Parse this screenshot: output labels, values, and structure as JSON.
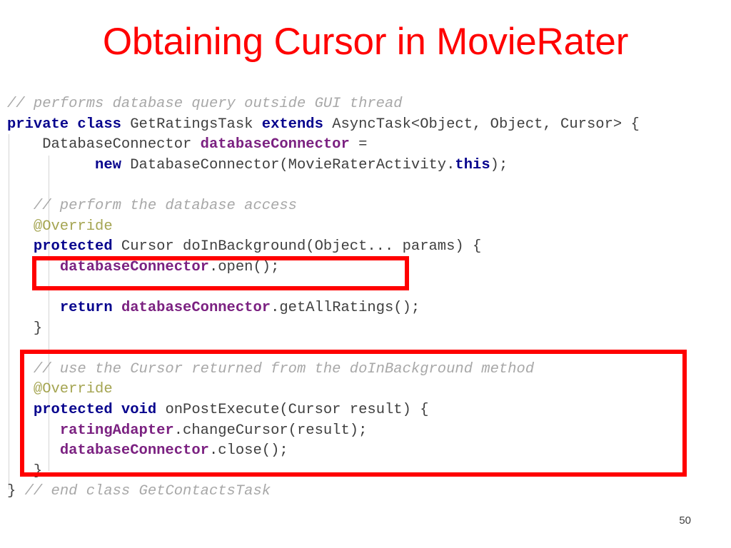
{
  "slide": {
    "title": "Obtaining Cursor in MovieRater",
    "title_color": "#ff0000",
    "page_number": "50",
    "background_color": "#ffffff"
  },
  "syntax_colors": {
    "comment": "#a8a8a8",
    "keyword": "#06038d",
    "variable": "#7b2181",
    "annotation": "#a5a552",
    "plain": "#3f3f3f",
    "highlight_box": "#ff0000"
  },
  "code": {
    "language": "java",
    "lines": [
      {
        "id": "line-1",
        "tokens": [
          {
            "t": "cmt",
            "s": "// performs database query outside GUI thread"
          }
        ]
      },
      {
        "id": "line-2",
        "tokens": [
          {
            "t": "kw",
            "s": "private class"
          },
          {
            "t": "pln",
            "s": " GetRatingsTask "
          },
          {
            "t": "kw",
            "s": "extends"
          },
          {
            "t": "pln",
            "s": " AsyncTask<Object, Object, Cursor> {"
          }
        ]
      },
      {
        "id": "line-3",
        "tokens": [
          {
            "t": "pln",
            "s": "    DatabaseConnector "
          },
          {
            "t": "var",
            "s": "databaseConnector"
          },
          {
            "t": "pln",
            "s": " ="
          }
        ]
      },
      {
        "id": "line-4",
        "tokens": [
          {
            "t": "pln",
            "s": "          "
          },
          {
            "t": "kw",
            "s": "new"
          },
          {
            "t": "pln",
            "s": " DatabaseConnector(MovieRaterActivity."
          },
          {
            "t": "kw",
            "s": "this"
          },
          {
            "t": "pln",
            "s": ");"
          }
        ]
      },
      {
        "id": "line-5",
        "tokens": [
          {
            "t": "pln",
            "s": ""
          }
        ]
      },
      {
        "id": "line-6",
        "tokens": [
          {
            "t": "pln",
            "s": "   "
          },
          {
            "t": "cmt",
            "s": "// perform the database access"
          }
        ]
      },
      {
        "id": "line-7",
        "tokens": [
          {
            "t": "pln",
            "s": "   "
          },
          {
            "t": "ann",
            "s": "@Override"
          }
        ]
      },
      {
        "id": "line-8",
        "tokens": [
          {
            "t": "pln",
            "s": "   "
          },
          {
            "t": "kw",
            "s": "protected"
          },
          {
            "t": "pln",
            "s": " Cursor doInBackground(Object... params) {"
          }
        ]
      },
      {
        "id": "line-9",
        "tokens": [
          {
            "t": "pln",
            "s": "      "
          },
          {
            "t": "var",
            "s": "databaseConnector"
          },
          {
            "t": "pln",
            "s": ".open();"
          }
        ]
      },
      {
        "id": "line-10",
        "tokens": [
          {
            "t": "pln",
            "s": ""
          }
        ]
      },
      {
        "id": "line-11",
        "tokens": [
          {
            "t": "pln",
            "s": "      "
          },
          {
            "t": "kw",
            "s": "return"
          },
          {
            "t": "pln",
            "s": " "
          },
          {
            "t": "var",
            "s": "databaseConnector"
          },
          {
            "t": "pln",
            "s": ".getAllRatings();"
          }
        ]
      },
      {
        "id": "line-12",
        "tokens": [
          {
            "t": "pln",
            "s": "   }"
          }
        ]
      },
      {
        "id": "line-13",
        "tokens": [
          {
            "t": "pln",
            "s": ""
          }
        ]
      },
      {
        "id": "line-14",
        "tokens": [
          {
            "t": "pln",
            "s": "   "
          },
          {
            "t": "cmt",
            "s": "// use the Cursor returned from the doInBackground method"
          }
        ]
      },
      {
        "id": "line-15",
        "tokens": [
          {
            "t": "pln",
            "s": "   "
          },
          {
            "t": "ann",
            "s": "@Override"
          }
        ]
      },
      {
        "id": "line-16",
        "tokens": [
          {
            "t": "pln",
            "s": "   "
          },
          {
            "t": "kw",
            "s": "protected void"
          },
          {
            "t": "pln",
            "s": " onPostExecute(Cursor result) {"
          }
        ]
      },
      {
        "id": "line-17",
        "tokens": [
          {
            "t": "pln",
            "s": "      "
          },
          {
            "t": "var",
            "s": "ratingAdapter"
          },
          {
            "t": "pln",
            "s": ".changeCursor(result);"
          }
        ]
      },
      {
        "id": "line-18",
        "tokens": [
          {
            "t": "pln",
            "s": "      "
          },
          {
            "t": "var",
            "s": "databaseConnector"
          },
          {
            "t": "pln",
            "s": ".close();"
          }
        ]
      },
      {
        "id": "line-19",
        "tokens": [
          {
            "t": "pln",
            "s": "   }"
          }
        ]
      },
      {
        "id": "line-20",
        "tokens": [
          {
            "t": "pln",
            "s": "} "
          },
          {
            "t": "cmt",
            "s": "// end class GetContactsTask"
          }
        ]
      }
    ]
  },
  "highlights": [
    {
      "id": "highlight-open",
      "label": "databaseConnector.open();"
    },
    {
      "id": "highlight-post",
      "label": "onPostExecute block"
    }
  ]
}
